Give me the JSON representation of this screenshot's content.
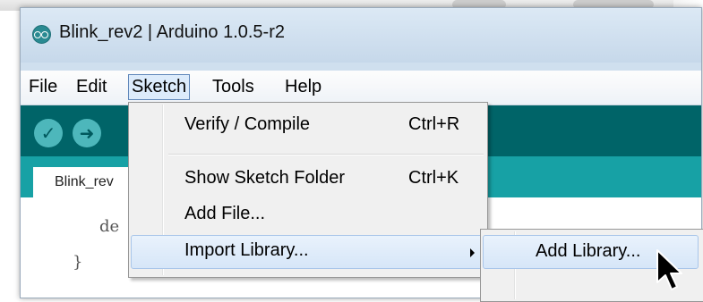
{
  "window": {
    "title": "Blink_rev2 | Arduino 1.0.5-r2"
  },
  "menubar": {
    "items": [
      {
        "label": "File"
      },
      {
        "label": "Edit"
      },
      {
        "label": "Sketch",
        "active": true
      },
      {
        "label": "Tools"
      },
      {
        "label": "Help"
      }
    ]
  },
  "toolbar": {
    "verify_icon": "check-icon",
    "upload_icon": "arrow-right-icon",
    "verify_glyph": "✓",
    "upload_glyph": "➜"
  },
  "tabs": [
    {
      "label": "Blink_rev"
    }
  ],
  "editor": {
    "lines": [
      "de",
      "}"
    ]
  },
  "sketch_menu": {
    "items": [
      {
        "label": "Verify / Compile",
        "shortcut": "Ctrl+R"
      },
      {
        "label": "Show Sketch Folder",
        "shortcut": "Ctrl+K"
      },
      {
        "label": "Add File..."
      },
      {
        "label": "Import Library...",
        "submenu": true,
        "highlighted": true
      }
    ]
  },
  "import_library_submenu": {
    "items": [
      {
        "label": "Add Library...",
        "highlighted": true
      }
    ]
  },
  "colors": {
    "toolbar": "#006468",
    "tabstrip": "#17a1a5",
    "toolbar_button": "#4db7bb",
    "highlight": "#d6e6f8"
  }
}
